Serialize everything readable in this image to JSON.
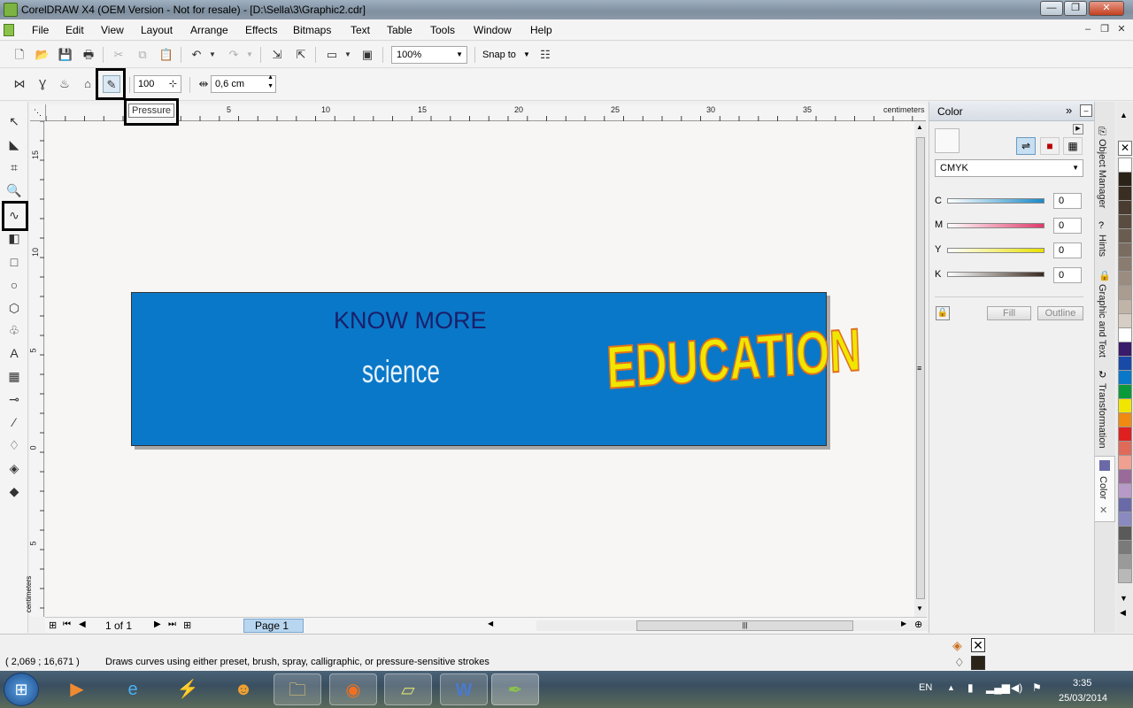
{
  "window": {
    "title": "CorelDRAW X4 (OEM Version - Not for resale) - [D:\\Sella\\3\\Graphic2.cdr]",
    "minimize": "—",
    "restore": "❐",
    "close": "✕"
  },
  "menu": [
    "File",
    "Edit",
    "View",
    "Layout",
    "Arrange",
    "Effects",
    "Bitmaps",
    "Text",
    "Table",
    "Tools",
    "Window",
    "Help"
  ],
  "std_toolbar": {
    "zoom_value": "100%",
    "snap_to": "Snap to"
  },
  "property_bar": {
    "pressure_value": "100",
    "width_value": "0,6 cm",
    "tooltip": "Pressure"
  },
  "ruler": {
    "h_ticks": [
      "5",
      "10",
      "15",
      "20",
      "25",
      "30",
      "35"
    ],
    "h_unit": "centimeters",
    "v_ticks": [
      "15",
      "10",
      "5",
      "0",
      "5"
    ],
    "v_unit": "centimeters"
  },
  "canvas": {
    "know": "KNOW MORE",
    "science": "science",
    "education": "EDUCATION"
  },
  "page_nav": {
    "count": "1 of 1",
    "tab": "Page 1"
  },
  "docker": {
    "title": "Color",
    "model": "CMYK",
    "channels": [
      {
        "label": "C",
        "value": "0",
        "color": "#1a8ac8"
      },
      {
        "label": "M",
        "value": "0",
        "color": "#e03a6a"
      },
      {
        "label": "Y",
        "value": "0",
        "color": "#e8e000"
      },
      {
        "label": "K",
        "value": "0",
        "color": "#3a2a20"
      }
    ],
    "fill": "Fill",
    "outline": "Outline"
  },
  "side_tabs": [
    "Object Manager",
    "Hints",
    "Graphic and Text",
    "Transformation",
    "Color"
  ],
  "palette": [
    "#ffffff",
    "#2b2218",
    "#3a2d22",
    "#4a3c30",
    "#5a4c40",
    "#6a5c50",
    "#7a6c60",
    "#8a7c70",
    "#9a8c80",
    "#aa9c90",
    "#c0b4a8",
    "#d6cec4",
    "#ffffff",
    "#3a1a6a",
    "#1a4aa8",
    "#0a78c8",
    "#0a9a3a",
    "#f0e600",
    "#f08a10",
    "#e02020",
    "#e06a5a",
    "#f0a090",
    "#9a6a9a",
    "#b89ac8",
    "#6a6aa8",
    "#8a8ac0",
    "#5a5a5a",
    "#7a7a7a",
    "#9a9a9a",
    "#b8b8b8"
  ],
  "status": {
    "coords": "( 2,069 ; 16,671 )",
    "message": "Draws curves using either preset, brush, spray, calligraphic, or pressure-sensitive strokes"
  },
  "taskbar": {
    "lang": "EN",
    "time": "3:35",
    "date": "25/03/2014"
  }
}
